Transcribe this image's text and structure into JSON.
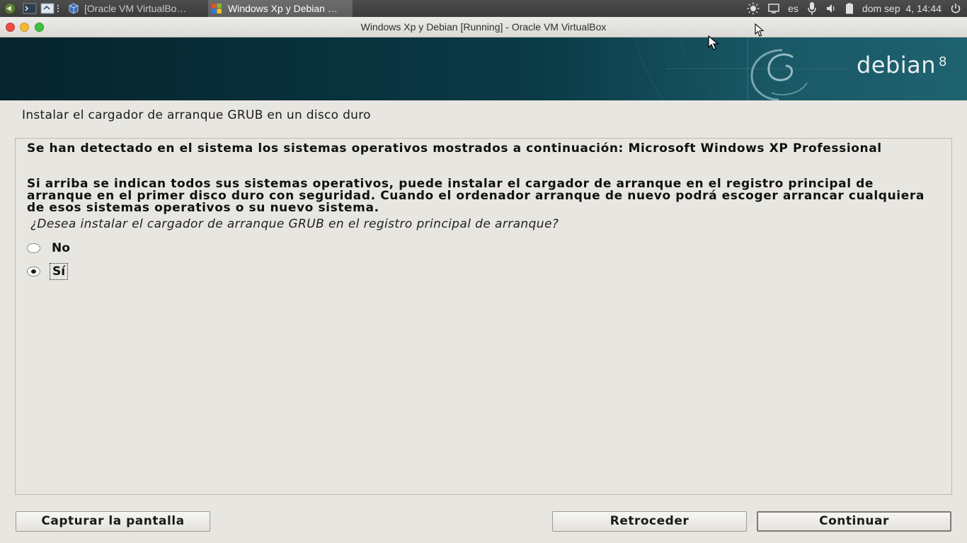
{
  "taskbar": {
    "tasks": [
      {
        "label": "[Oracle VM VirtualBo…",
        "icon": "virtualbox-icon"
      },
      {
        "label": "Windows Xp y Debian …",
        "icon": "windows-xp-icon"
      }
    ],
    "keyboard_layout": "es",
    "clock": "dom sep  4, 14:44"
  },
  "window": {
    "title": "Windows Xp y Debian [Running] - Oracle VM VirtualBox"
  },
  "banner": {
    "brand": "debian",
    "version": "8"
  },
  "installer": {
    "page_title": "Instalar el cargador de arranque GRUB en un disco duro",
    "detected_text": "Se han detectado en el sistema los sistemas operativos mostrados a continuación: Microsoft Windows XP Professional",
    "info_text": "Si arriba se indican todos sus sistemas operativos, puede instalar el cargador de arranque en el registro principal de arranque en el primer disco duro con seguridad. Cuando el ordenador arranque de nuevo podrá escoger arrancar cualquiera de esos sistemas operativos o su nuevo sistema.",
    "question": "¿Desea instalar el cargador de arranque GRUB en el registro principal de arranque?",
    "options": [
      {
        "label": "No",
        "selected": false
      },
      {
        "label": "Sí",
        "selected": true
      }
    ]
  },
  "buttons": {
    "screenshot": "Capturar la pantalla",
    "back": "Retroceder",
    "continue": "Continuar"
  },
  "colors": {
    "close": "#ee4c40",
    "minimize": "#f6b834",
    "maximize": "#3ec13c",
    "banner": "#0a3a46"
  }
}
